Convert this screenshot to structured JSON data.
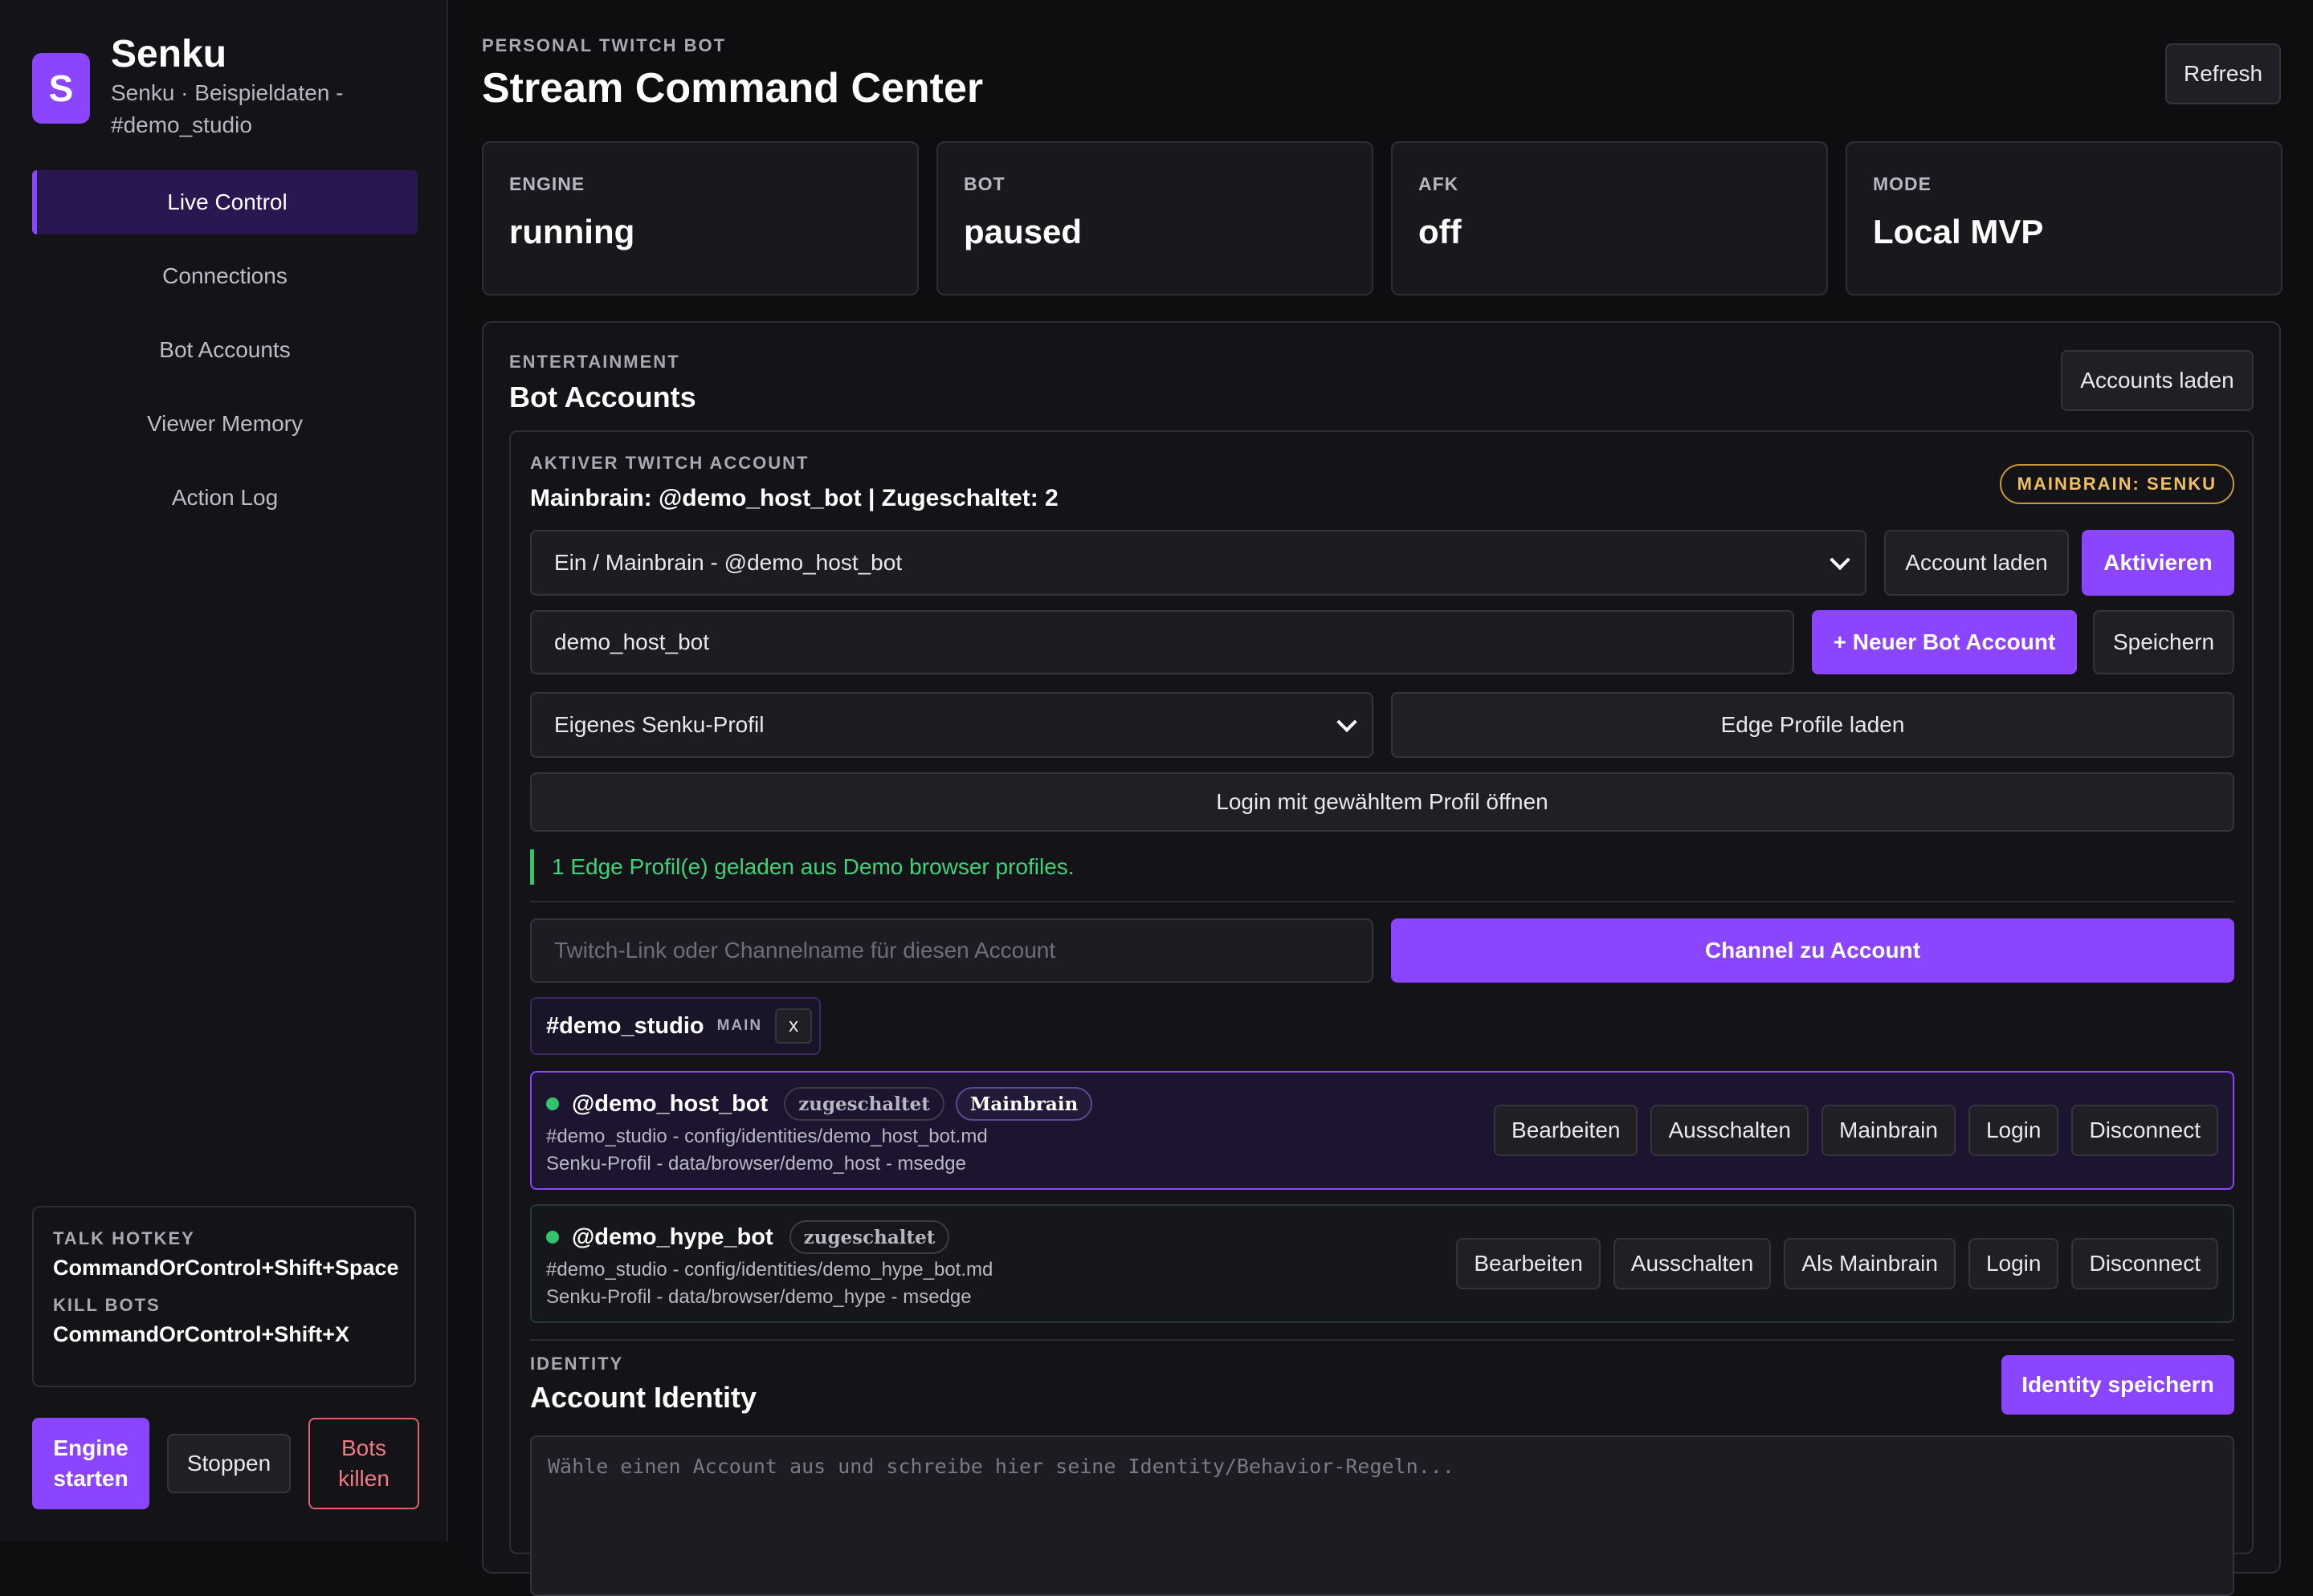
{
  "brand": {
    "logo_letter": "S",
    "name": "Senku",
    "subtitle": "Senku · Beispieldaten - #demo_studio"
  },
  "sidebar": {
    "items": [
      {
        "label": "Live Control",
        "active": true
      },
      {
        "label": "Connections",
        "active": false
      },
      {
        "label": "Bot Accounts",
        "active": false
      },
      {
        "label": "Viewer Memory",
        "active": false
      },
      {
        "label": "Action Log",
        "active": false
      }
    ],
    "hotkeys": {
      "talk_label": "TALK HOTKEY",
      "talk_value": "CommandOrControl+Shift+Space",
      "kill_label": "KILL BOTS",
      "kill_value": "CommandOrControl+Shift+X"
    },
    "actions": {
      "engine_start": "Engine starten",
      "stop": "Stoppen",
      "kill": "Bots killen"
    }
  },
  "header": {
    "eyebrow": "PERSONAL TWITCH BOT",
    "title": "Stream Command Center",
    "refresh": "Refresh"
  },
  "stats": [
    {
      "label": "ENGINE",
      "value": "running"
    },
    {
      "label": "BOT",
      "value": "paused"
    },
    {
      "label": "AFK",
      "value": "off"
    },
    {
      "label": "MODE",
      "value": "Local MVP"
    }
  ],
  "panel": {
    "eyebrow": "ENTERTAINMENT",
    "title": "Bot Accounts",
    "load_accounts": "Accounts laden",
    "active": {
      "eyebrow": "AKTIVER TWITCH ACCOUNT",
      "summary": "Mainbrain: @demo_host_bot | Zugeschaltet: 2",
      "badge": "MAINBRAIN: SENKU",
      "select_value": "Ein / Mainbrain - @demo_host_bot",
      "load_account": "Account laden",
      "activate": "Aktivieren",
      "name_value": "demo_host_bot",
      "new_account": "+ Neuer Bot Account",
      "save": "Speichern",
      "profile_select": "Eigenes Senku-Profil",
      "load_edge": "Edge Profile laden",
      "login_profile": "Login mit gewähltem Profil öffnen",
      "status": "1 Edge Profil(e) geladen aus Demo browser profiles.",
      "channel_placeholder": "Twitch-Link oder Channelname für diesen Account",
      "channel_button": "Channel zu Account",
      "chip": {
        "name": "#demo_studio",
        "tag": "MAIN",
        "remove": "x"
      }
    },
    "accounts": [
      {
        "name": "@demo_host_bot",
        "pills": [
          "zugeschaltet",
          "Mainbrain"
        ],
        "meta1": "#demo_studio - config/identities/demo_host_bot.md",
        "meta2": "Senku-Profil - data/browser/demo_host - msedge",
        "actions": [
          "Bearbeiten",
          "Ausschalten",
          "Mainbrain",
          "Login",
          "Disconnect"
        ]
      },
      {
        "name": "@demo_hype_bot",
        "pills": [
          "zugeschaltet"
        ],
        "meta1": "#demo_studio - config/identities/demo_hype_bot.md",
        "meta2": "Senku-Profil - data/browser/demo_hype - msedge",
        "actions": [
          "Bearbeiten",
          "Ausschalten",
          "Als Mainbrain",
          "Login",
          "Disconnect"
        ]
      }
    ],
    "identity": {
      "eyebrow": "IDENTITY",
      "title": "Account Identity",
      "save": "Identity speichern",
      "placeholder": "Wähle einen Account aus und schreibe hier seine Identity/Behavior-Regeln..."
    }
  },
  "colors": {
    "accent": "#8b45ff",
    "success": "#31c46d",
    "danger": "#e0606a",
    "gold": "#f0c060"
  }
}
